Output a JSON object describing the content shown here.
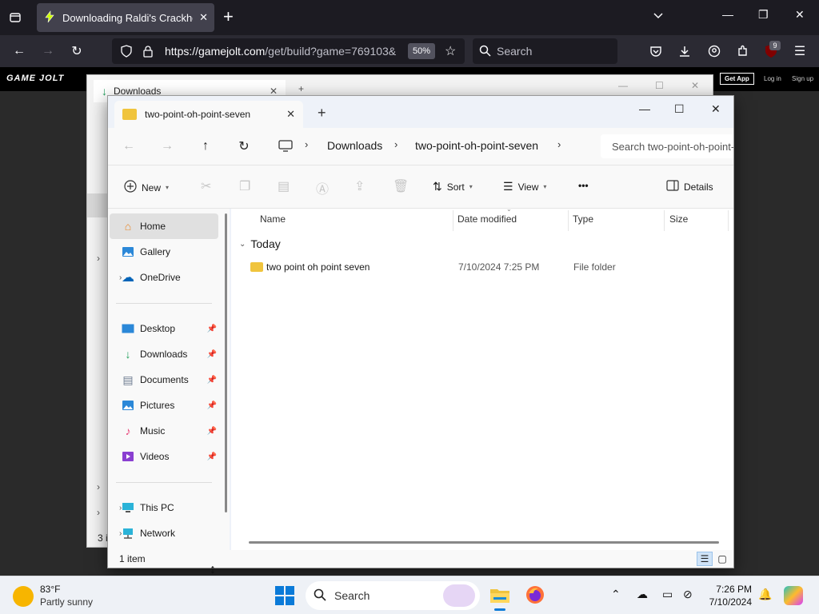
{
  "browser": {
    "tab_title": "Downloading Raldi's Crackhouse",
    "url_host": "https://gamejolt.com",
    "url_rest": "/get/build?game=769103&",
    "zoom": "50%",
    "search_placeholder": "Search",
    "badge_count": "9"
  },
  "gamejolt": {
    "logo": "GAME JOLT",
    "get_app": "Get App",
    "login": "Log in",
    "signup": "Sign up"
  },
  "bg_window": {
    "tab_title": "Downloads",
    "status": "3 i"
  },
  "explorer": {
    "tab_title": "two-point-oh-point-seven",
    "breadcrumb": [
      "Downloads",
      "two-point-oh-point-seven"
    ],
    "search_placeholder": "Search two-point-oh-point-seven",
    "commands": {
      "new": "New",
      "sort": "Sort",
      "view": "View",
      "more": "•••",
      "details": "Details"
    },
    "nav": {
      "home": "Home",
      "gallery": "Gallery",
      "onedrive": "OneDrive",
      "desktop": "Desktop",
      "downloads": "Downloads",
      "documents": "Documents",
      "pictures": "Pictures",
      "music": "Music",
      "videos": "Videos",
      "thispc": "This PC",
      "network": "Network"
    },
    "columns": {
      "name": "Name",
      "date": "Date modified",
      "type": "Type",
      "size": "Size"
    },
    "group": "Today",
    "files": [
      {
        "name": "two point oh point seven",
        "date": "7/10/2024 7:25 PM",
        "type": "File folder",
        "size": ""
      }
    ],
    "status": "1 item"
  },
  "taskbar": {
    "temp": "83°F",
    "weather": "Partly sunny",
    "search": "Search",
    "time": "7:26 PM",
    "date": "7/10/2024"
  },
  "colors": {
    "accent": "#0a7ad8",
    "folder": "#f0c43d",
    "firefox_dark": "#1c1b22"
  }
}
